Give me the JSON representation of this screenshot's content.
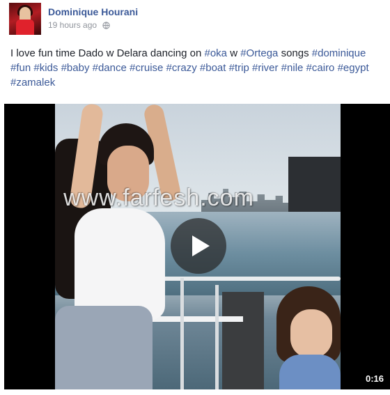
{
  "post": {
    "author": "Dominique Hourani",
    "timestamp": "19 hours ago",
    "privacy_icon": "globe-icon",
    "text_plain_1": "I love fun time Dado w Delara dancing on ",
    "tag_oka": "#oka",
    "text_plain_2": " w ",
    "tag_ortega": "#Ortega",
    "text_plain_3": " songs ",
    "hashtags": [
      "#dominique",
      "#fun",
      "#kids",
      "#baby",
      "#dance",
      "#cruise",
      "#crazy",
      "#boat",
      "#trip",
      "#river",
      "#nile",
      "#cairo",
      "#egypt",
      "#zamalek"
    ]
  },
  "video": {
    "watermark": "www.farfesh.com",
    "duration": "0:16",
    "play_icon": "play-icon"
  },
  "colors": {
    "link": "#3b5998",
    "text": "#1d2129",
    "meta": "#90949c"
  }
}
